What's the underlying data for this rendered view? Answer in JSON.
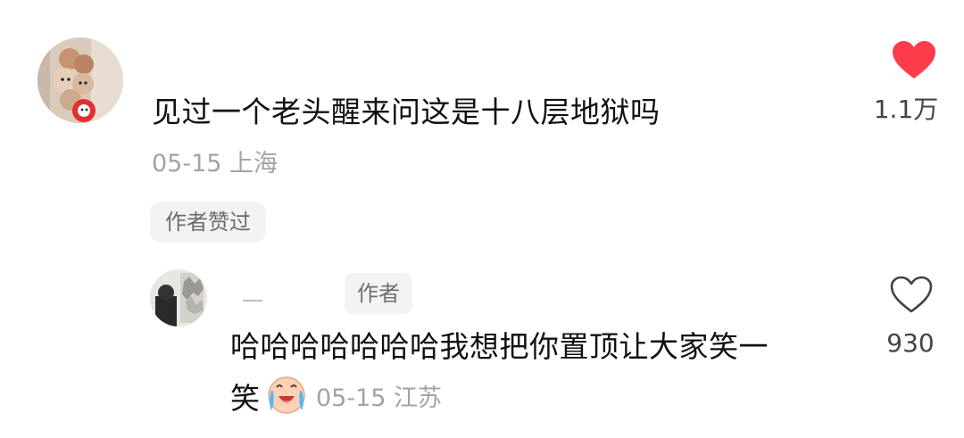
{
  "comment": {
    "text": "见过一个老头醒来问这是十八层地狱吗",
    "date": "05-15",
    "location": "上海",
    "meta_text": "05-15 上海",
    "liked_badge": "作者赞过",
    "like_count": "1.1万",
    "liked": true,
    "avatar_icon": "plush-toys-avatar"
  },
  "reply": {
    "author_tag": "作者",
    "text_line1": "哈哈哈哈哈哈哈我想把你置顶让大家笑一",
    "text_line2": "笑",
    "emoji": "crying-laughing-emoji",
    "date": "05-15",
    "location": "江苏",
    "meta_text": "05-15 江苏",
    "like_count": "930",
    "liked": false,
    "avatar_icon": "dark-photo-avatar"
  },
  "colors": {
    "heart_red": "#fd3b4b",
    "text": "#111111",
    "meta": "#a3a3a3",
    "badge_bg": "#f3f3f3"
  }
}
